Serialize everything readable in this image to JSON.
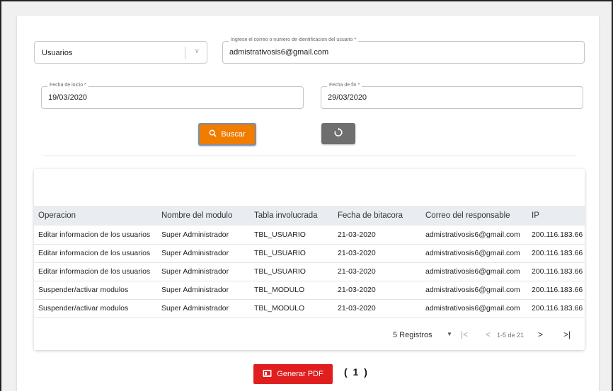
{
  "filters": {
    "type_select": "Usuarios",
    "email_label": "Ingrese el correo o numero de identificacion del usuario *",
    "email_value": "admistrativosis6@gmail.com",
    "start_label": "Fecha de inicio *",
    "start_value": "19/03/2020",
    "end_label": "Fecha de fin *",
    "end_value": "29/03/2020"
  },
  "buttons": {
    "search_label": "Buscar",
    "pdf_label": "Generar PDF",
    "search_color": "#f07c00",
    "pdf_color": "#e01e1e"
  },
  "table": {
    "headers": [
      "Operacion",
      "Nombre del modulo",
      "Tabla involucrada",
      "Fecha de bitacora",
      "Correo del responsable",
      "IP"
    ],
    "rows": [
      [
        "Editar informacion de los usuarios",
        "Super Administrador",
        "TBL_USUARIO",
        "21-03-2020",
        "admistrativosis6@gmail.com",
        "200.116.183.66"
      ],
      [
        "Editar informacion de los usuarios",
        "Super Administrador",
        "TBL_USUARIO",
        "21-03-2020",
        "admistrativosis6@gmail.com",
        "200.116.183.66"
      ],
      [
        "Editar informacion de los usuarios",
        "Super Administrador",
        "TBL_USUARIO",
        "21-03-2020",
        "admistrativosis6@gmail.com",
        "200.116.183.66"
      ],
      [
        "Suspender/activar modulos",
        "Super Administrador",
        "TBL_MODULO",
        "21-03-2020",
        "admistrativosis6@gmail.com",
        "200.116.183.66"
      ],
      [
        "Suspender/activar modulos",
        "Super Administrador",
        "TBL_MODULO",
        "21-03-2020",
        "admistrativosis6@gmail.com",
        "200.116.183.66"
      ]
    ]
  },
  "pagination": {
    "rows_per_page": "5 Registros",
    "range": "1-5 de 21"
  },
  "result_count": "( 1 )"
}
